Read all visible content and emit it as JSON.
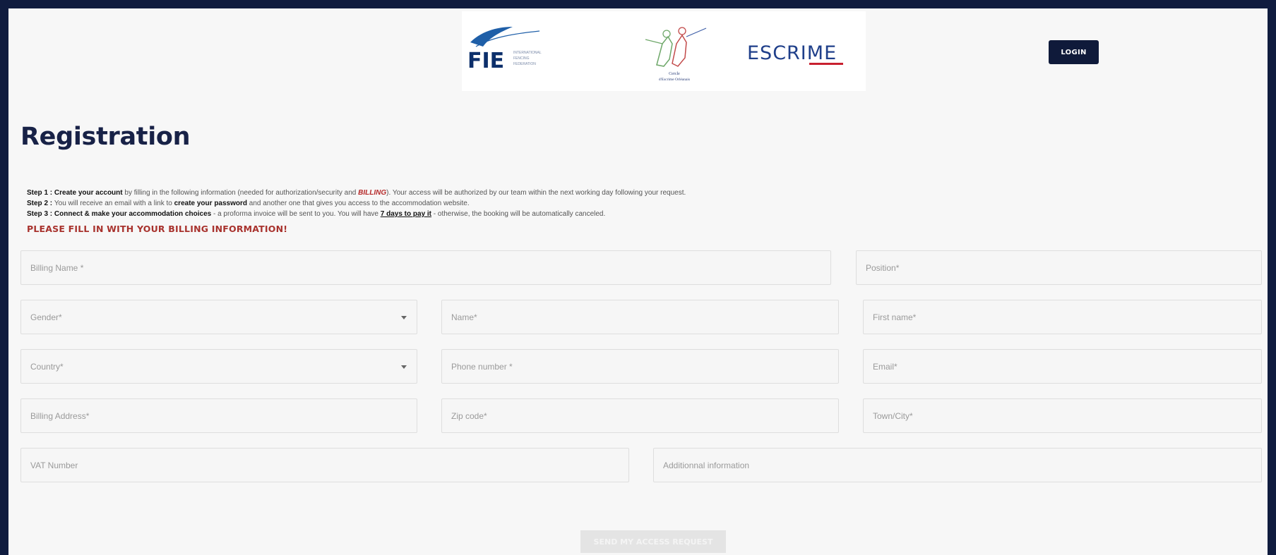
{
  "header": {
    "logos": {
      "fie": {
        "letters": "FIE",
        "subtitle": [
          "INTERNATIONAL",
          "FENCING",
          "FEDERATION"
        ]
      },
      "cercle": {
        "text": [
          "Cercle",
          "d'Escrime Orléanais"
        ]
      },
      "escrime": {
        "text": "ESCRIME"
      }
    },
    "login_label": "LOGIN"
  },
  "main": {
    "title": "Registration",
    "steps": {
      "step1_label": "Step 1 : ",
      "step1_bold": "Create your account",
      "step1_text": " by filling in the following information (needed for authorization/security and ",
      "step1_billing": "BILLING",
      "step1_rest": "). Your access will be authorized by our team within the next working day following your request.",
      "step2_label": "Step 2 : ",
      "step2_text": "You will receive an email with a link to ",
      "step2_bold": "create your password",
      "step2_rest": " and another one that gives you access to the accommodation website.",
      "step3_label": "Step 3 : ",
      "step3_bold": "Connect & make your accommodation choices",
      "step3_text": " - a proforma invoice will be sent to you. You will have ",
      "step3_underline": "7 days to pay it",
      "step3_rest": " - otherwise, the booking will be automatically canceled."
    },
    "warning": "PLEASE FILL IN WITH YOUR BILLING INFORMATION!",
    "fields": {
      "billing_name": "Billing Name *",
      "position": "Position*",
      "gender": "Gender*",
      "name": "Name*",
      "first_name": "First name*",
      "country": "Country*",
      "phone": "Phone number *",
      "email": "Email*",
      "billing_address": "Billing Address*",
      "zip": "Zip code*",
      "town": "Town/City*",
      "vat": "VAT Number",
      "additional": "Additionnal information"
    },
    "send_label": "SEND MY ACCESS REQUEST"
  },
  "colors": {
    "frame": "#101c3f",
    "title": "#182247",
    "accent_red": "#a8322d",
    "login_bg": "#0f1a3a",
    "escrime_red": "#c8202f"
  }
}
